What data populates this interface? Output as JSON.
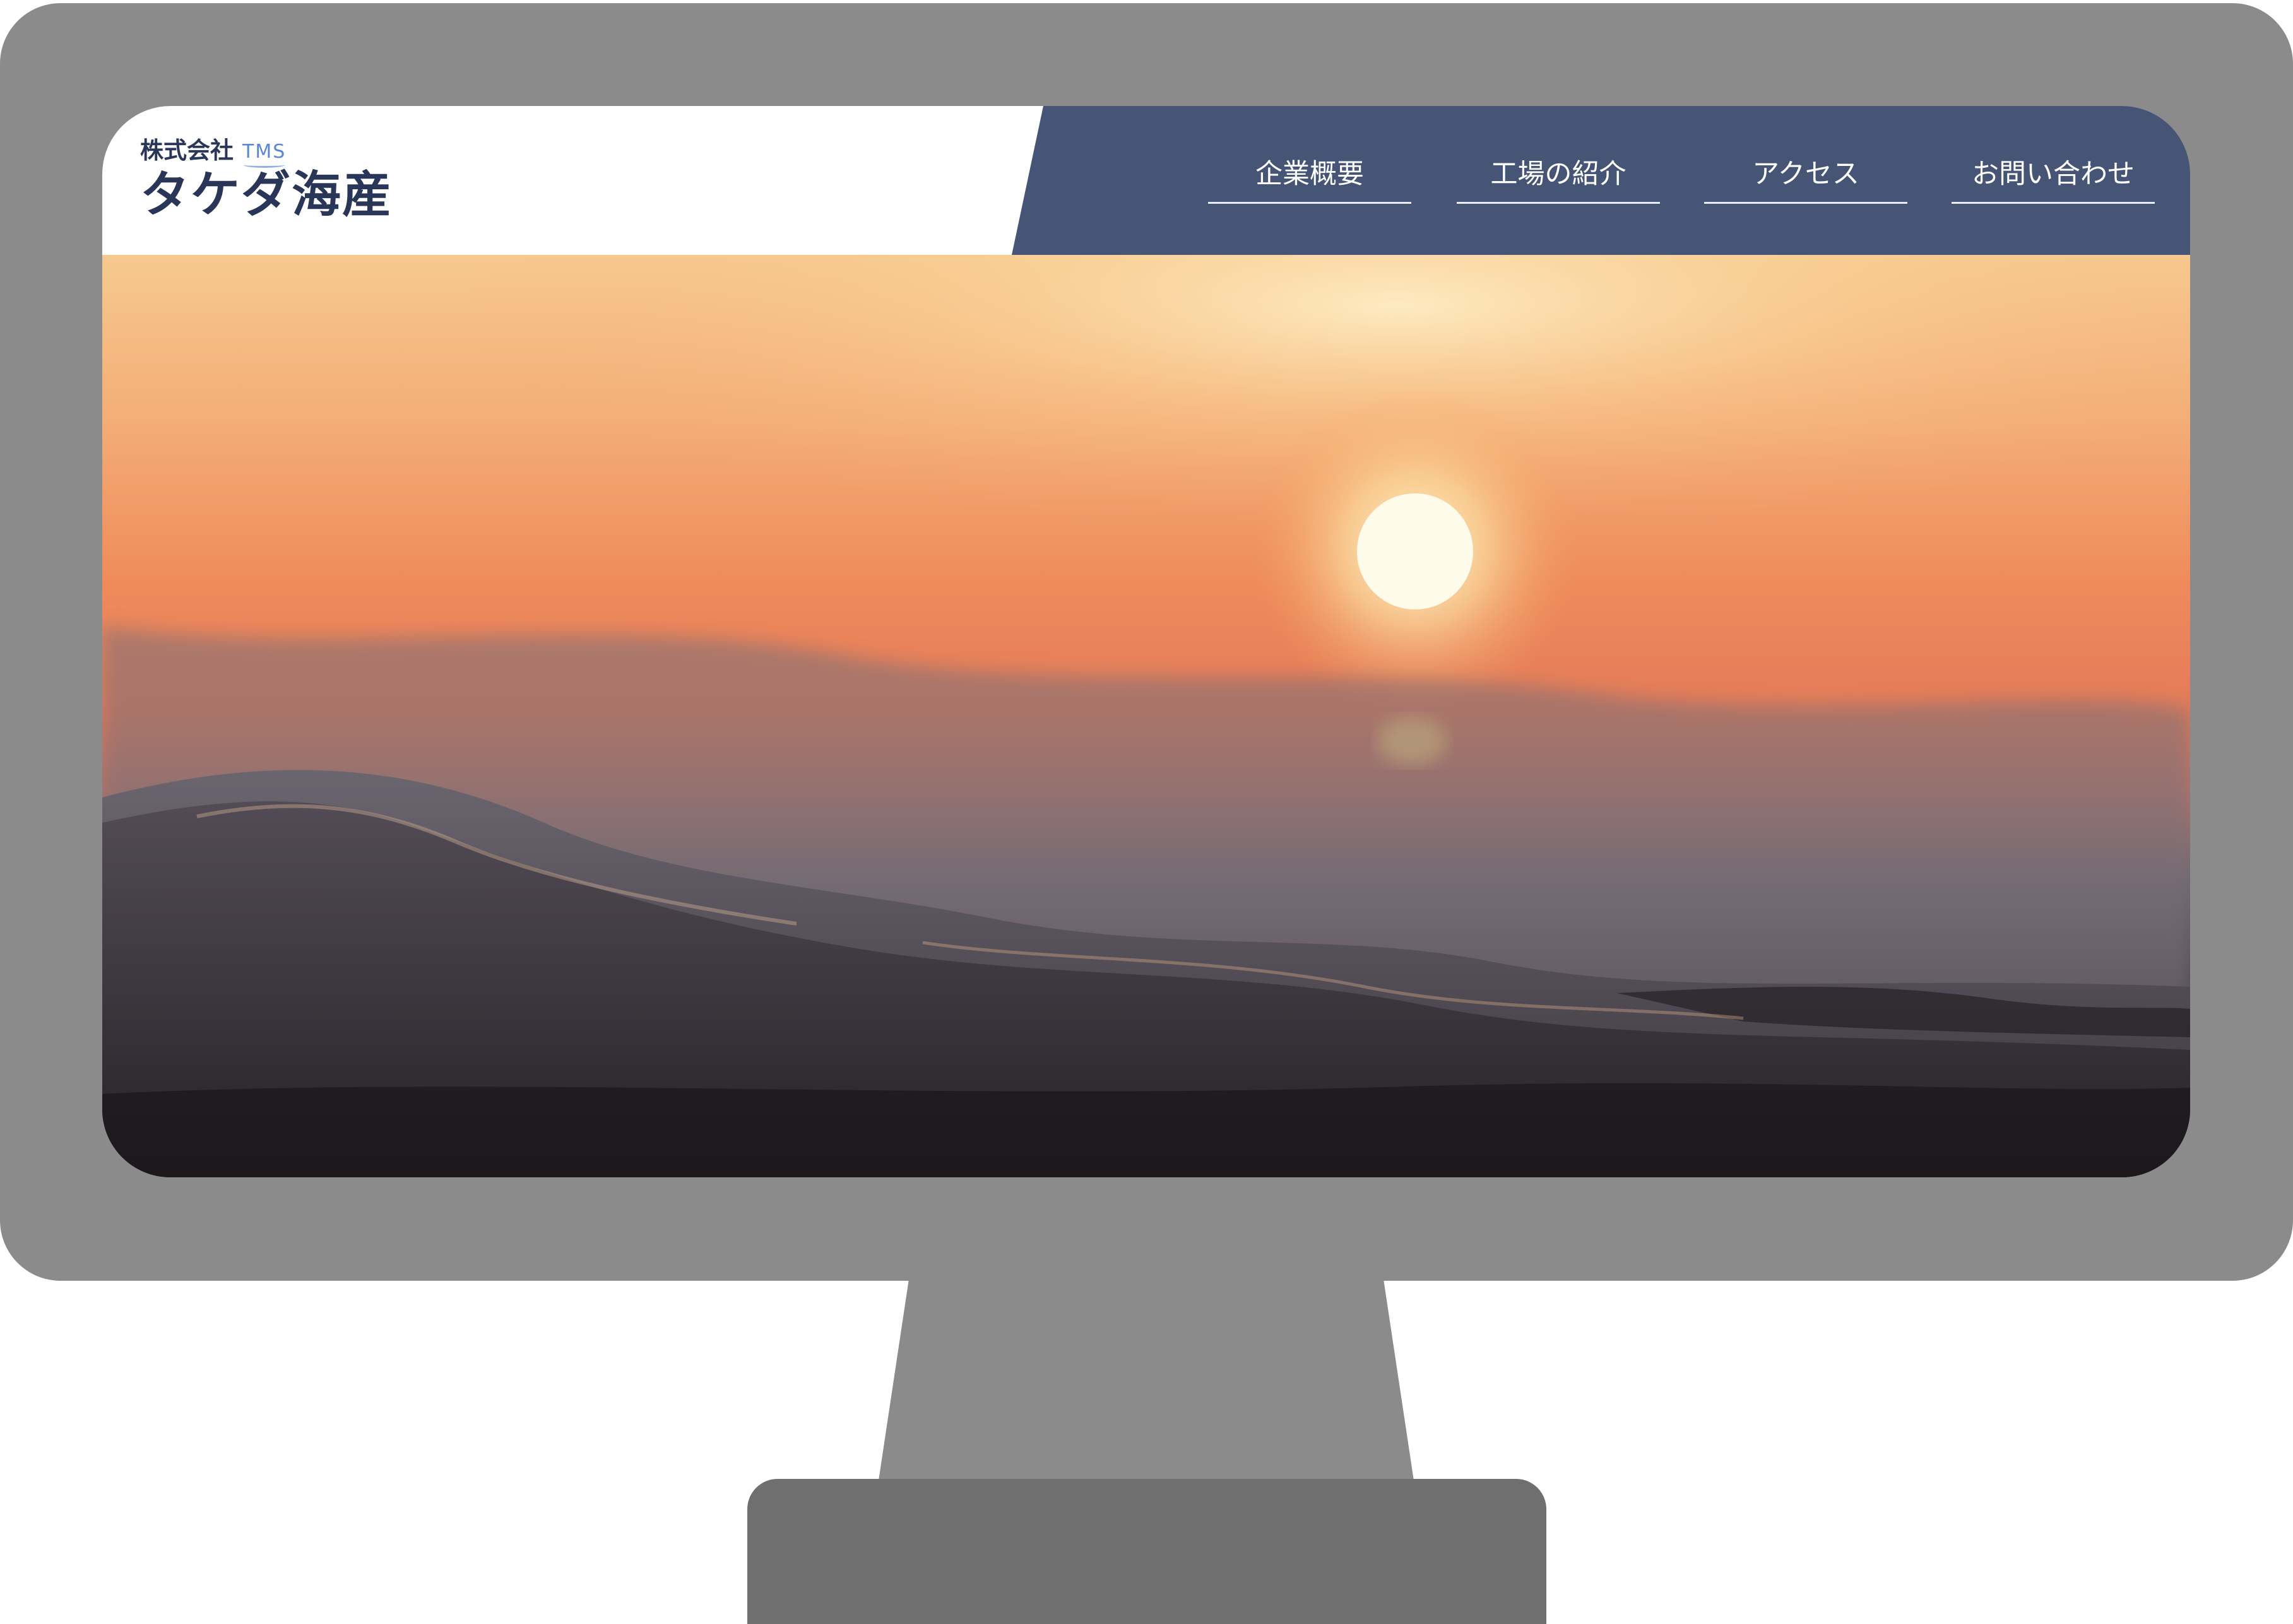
{
  "site": {
    "logo": {
      "company_prefix": "株式会社",
      "mark": "TMS",
      "name": "タケダ海産"
    },
    "nav": [
      {
        "label": "企業概要"
      },
      {
        "label": "工場の紹介"
      },
      {
        "label": "アクセス"
      },
      {
        "label": "お問い合わせ"
      }
    ],
    "hero": {
      "scene": "sunset-over-ocean-waves"
    }
  },
  "colors": {
    "header_navy": "#465476",
    "logo_text": "#2a3658",
    "logo_mark": "#5b86d6",
    "monitor_bezel": "#8b8b8b",
    "monitor_base": "#6f6f6f"
  }
}
